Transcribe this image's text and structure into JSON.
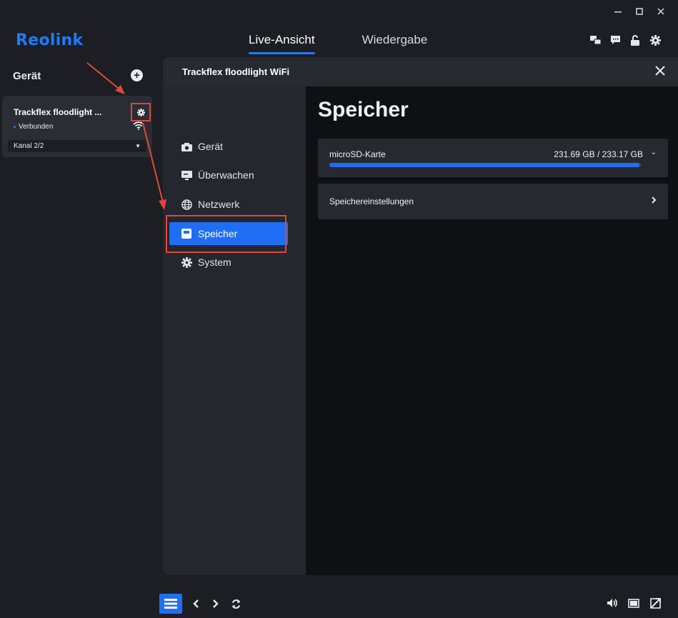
{
  "app": {
    "logo": "Reolink",
    "tabs": [
      {
        "label": "Live-Ansicht",
        "active": true
      },
      {
        "label": "Wiedergabe",
        "active": false
      }
    ],
    "top_icons": [
      "chat-translate-icon",
      "message-icon",
      "unlock-icon",
      "gear-icon"
    ],
    "window_controls": [
      "minimize-icon",
      "maximize-icon",
      "close-icon"
    ]
  },
  "sidebar": {
    "title": "Gerät",
    "add_icon": "plus-icon",
    "device": {
      "name": "Trackflex floodlight ...",
      "status": "Verbunden",
      "channel": "Kanal 2/2"
    }
  },
  "dialog": {
    "title": "Trackflex floodlight WiFi",
    "nav": [
      {
        "label": "Gerät",
        "icon": "camera-icon",
        "active": false
      },
      {
        "label": "Überwachen",
        "icon": "monitor-icon",
        "active": false
      },
      {
        "label": "Netzwerk",
        "icon": "globe-icon",
        "active": false
      },
      {
        "label": "Speicher",
        "icon": "storage-icon",
        "active": true
      },
      {
        "label": "System",
        "icon": "gear-icon",
        "active": false
      }
    ],
    "main": {
      "title": "Speicher",
      "sd_card": {
        "label": "microSD-Karte",
        "size": "231.69 GB / 233.17 GB",
        "usage_fraction": 0.994
      },
      "settings_label": "Speichereinstellungen"
    }
  },
  "colors": {
    "accent": "#1f6ef5",
    "brand": "#1f7bff",
    "annotation": "#e2463c"
  }
}
